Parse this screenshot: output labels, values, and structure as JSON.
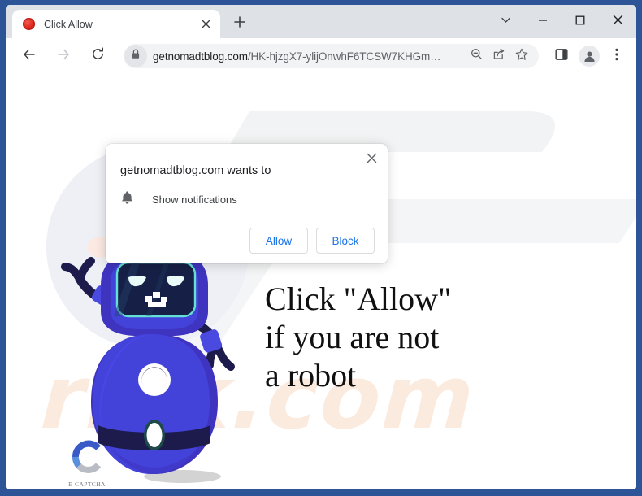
{
  "window": {
    "controls": [
      {
        "name": "tab-search",
        "glyph": "chevron-down-icon"
      },
      {
        "name": "minimize",
        "glyph": "minimize-icon"
      },
      {
        "name": "maximize",
        "glyph": "maximize-icon"
      },
      {
        "name": "close",
        "glyph": "close-icon"
      }
    ]
  },
  "tabstrip": {
    "tab_title": "Click Allow",
    "favicon": "red-dot-favicon",
    "close_icon": "close-icon",
    "newtab_icon": "plus-icon"
  },
  "toolbar": {
    "back_icon": "arrow-left-icon",
    "forward_icon": "arrow-right-icon",
    "reload_icon": "reload-icon",
    "lock_icon": "lock-icon",
    "url_host": "getnomadtblog.com",
    "url_path": "/HK-hjzgX7-ylijOnwhF6TCSW7KHGm…",
    "url_full": "getnomadtblog.com/HK-hjzgX7-ylijOnwhF6TCSW7KHGm…",
    "zoom_out_icon": "zoom-out-icon",
    "share_icon": "share-icon",
    "bookmark_icon": "star-icon",
    "side_panel_icon": "side-panel-icon",
    "profile_icon": "profile-avatar-icon",
    "menu_icon": "three-dot-menu-icon"
  },
  "notification": {
    "title": "getnomadtblog.com wants to",
    "permission": "Show notifications",
    "permission_icon": "bell-icon",
    "close_icon": "close-icon",
    "allow_label": "Allow",
    "block_label": "Block",
    "accent_color": "#1a73e8"
  },
  "page": {
    "headline": "Click \"Allow\"\nif you are not\na robot",
    "captcha_label": "E-CAPTCHA",
    "captcha_logo_icon": "c-logo-icon",
    "robot_illustration": "robot-mascot",
    "watermark_text": "risk.com",
    "colors": {
      "robot_body": "#4040d8",
      "robot_body_dark": "#3a34b8",
      "robot_outline": "#1c1b4b",
      "screen": "#162046",
      "screen_border": "#63e0d6",
      "background_circle": "#eef0f6",
      "watermark": "#fbeade",
      "shadow": "#d3d3d3"
    }
  }
}
